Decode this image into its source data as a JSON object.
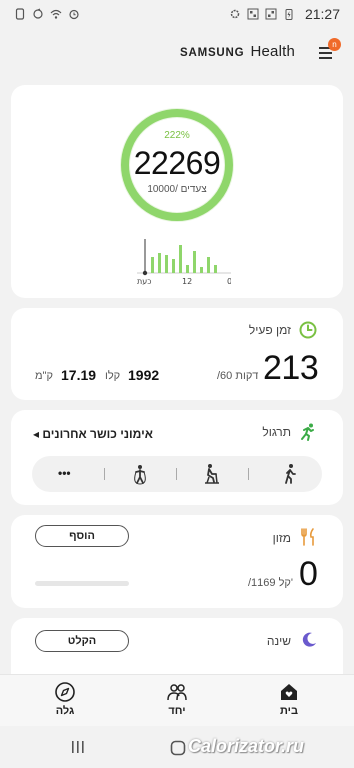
{
  "status_bar": {
    "time": "21:27",
    "icons_left": [
      "phone-icon",
      "sync-icon",
      "wifi-icon",
      "alarm-icon"
    ],
    "icons_right": [
      "settings-icon",
      "qr-icon",
      "qr-icon",
      "charging-battery-icon"
    ]
  },
  "header": {
    "brand_samsung": "SAMSUNG",
    "brand_health": "Health",
    "menu_badge": "n"
  },
  "steps": {
    "percent": "222%",
    "count": "22269",
    "goal": "צעדים /10000",
    "progress": 1.0,
    "chart_labels": {
      "now": "כעת",
      "mid": "12",
      "start": "0"
    },
    "ring_color": "#8fd66b"
  },
  "active_time": {
    "title": "זמן פעיל",
    "minutes": "213",
    "goal": "/60 דקות",
    "calories_value": "1992",
    "calories_unit": "קלו",
    "distance_value": "17.19",
    "distance_unit": "ק\"מ"
  },
  "exercise": {
    "title": "תרגול",
    "recent_label": "אימוני כושר אחרונים",
    "more_label": "•••",
    "items": [
      "walking-icon",
      "cycling-icon",
      "running-icon",
      "more-icon"
    ]
  },
  "food": {
    "title": "מזון",
    "add_button": "הוסף",
    "calories": "0",
    "goal": "/1169 קל'",
    "progress": 0
  },
  "sleep": {
    "title": "שינה",
    "record_button": "הקלט"
  },
  "bottom_nav": {
    "discover": "גלה",
    "together": "יחד",
    "home": "בית"
  },
  "watermark": "Calorizator.ru",
  "colors": {
    "accent_green": "#8fd66b",
    "exercise_green": "#4caf50",
    "food_orange": "#e79a3c",
    "sleep_purple": "#6a5acd",
    "badge_orange": "#f06a2a"
  }
}
